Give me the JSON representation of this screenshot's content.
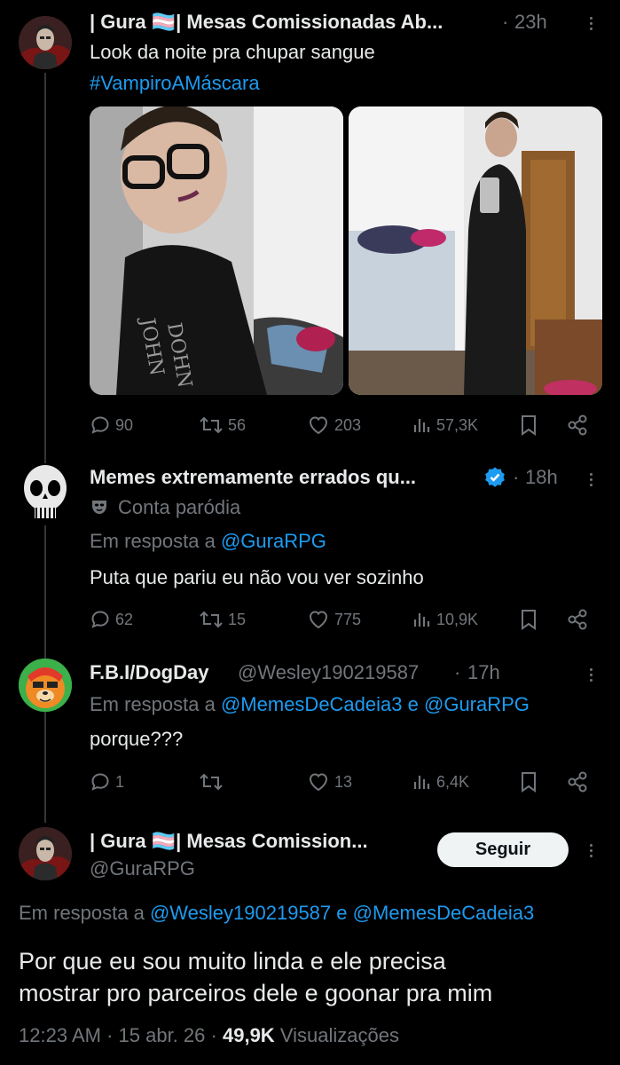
{
  "tweet1": {
    "name": "| Gura 🏳️‍⚧️| Mesas Comissionadas Ab...",
    "sep": "·",
    "time": "23h",
    "line1": "Look da noite pra chupar sangue",
    "hashtag": "#VampiroAMáscara",
    "replies": "90",
    "reposts": "56",
    "likes": "203",
    "views": "57,3K"
  },
  "tweet2": {
    "name": "Memes extremamente errados qu...",
    "sep": "·",
    "time": "18h",
    "label": "Conta paródia",
    "reply_prefix": "Em resposta a",
    "reply_to": "@GuraRPG",
    "text": "Puta que pariu eu não vou ver sozinho",
    "replies": "62",
    "reposts": "15",
    "likes": "775",
    "views": "10,9K"
  },
  "tweet3": {
    "name": "F.B.I/DogDay",
    "handle": "@Wesley190219587",
    "sep": "·",
    "time": "17h",
    "reply_prefix": "Em resposta a",
    "reply_to_1": "@MemesDeCadeia3",
    "conj": "e",
    "reply_to_2": "@GuraRPG",
    "text": "porque???",
    "replies": "1",
    "likes": "13",
    "views": "6,4K"
  },
  "main": {
    "name": "| Gura 🏳️‍⚧️| Mesas Comission...",
    "handle": "@GuraRPG",
    "follow": "Seguir",
    "reply_prefix": "Em resposta a",
    "reply_to_1": "@Wesley190219587",
    "conj": "e",
    "reply_to_2": "@MemesDeCadeia3",
    "text_line1": "Por que eu sou muito linda e ele precisa",
    "text_line2": "mostrar pro parceiros dele e goonar pra mim",
    "time": "12:23 AM",
    "sep1": "·",
    "date": "15 abr. 26",
    "sep2": "·",
    "views": "49,9K",
    "views_label": "Visualizações"
  },
  "colors": {
    "background": "#000000",
    "text": "#e7e9ea",
    "muted": "#71767b",
    "link": "#1d9bf0",
    "verified": "#1d9bf0"
  }
}
